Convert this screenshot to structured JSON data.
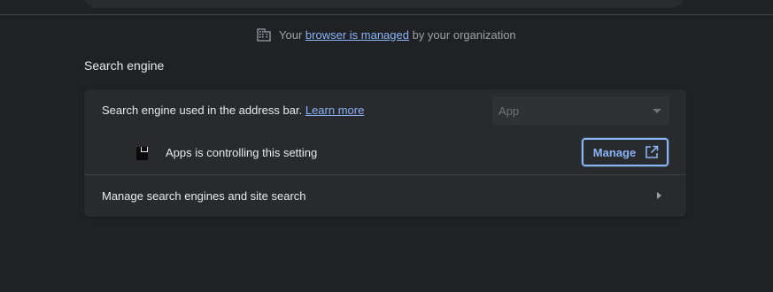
{
  "managed_notice": {
    "icon": "building-icon",
    "prefix": "Your",
    "link_text": "browser is managed",
    "suffix": "by your organization"
  },
  "search_engine": {
    "section_title": "Search engine",
    "address_bar_row": {
      "label": "Search engine used in the address bar.",
      "learn_more": "Learn more",
      "dropdown_value": "App"
    },
    "controlled_row": {
      "extension_icon": "app-extension-icon",
      "label": "Apps is controlling this setting",
      "manage_button": "Manage",
      "manage_icon": "open-in-new-icon"
    },
    "manage_engines_row": {
      "label": "Manage search engines and site search",
      "icon": "chevron-right-icon"
    }
  },
  "colors": {
    "background": "#202124",
    "card": "#292a2d",
    "accent": "#8ab4f8",
    "text_primary": "#e8eaed",
    "text_secondary": "#9aa0a6"
  }
}
